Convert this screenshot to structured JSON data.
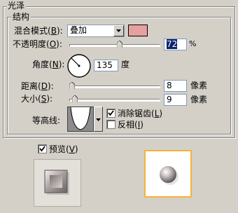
{
  "section_title": "光泽",
  "group_title": "结构",
  "blend_mode": {
    "label": "混合模式",
    "hotkey": "B",
    "value": "叠加",
    "color": "#e6a0a0"
  },
  "opacity": {
    "label": "不透明度",
    "hotkey": "O",
    "value": "72",
    "unit": "%",
    "level_percent": 72
  },
  "angle": {
    "label": "角度",
    "hotkey": "N",
    "value": "135",
    "unit": "度"
  },
  "distance": {
    "label": "距离",
    "hotkey": "D",
    "value": "8",
    "unit": "像素"
  },
  "size": {
    "label": "大小",
    "hotkey": "S",
    "value": "9",
    "unit": "像素"
  },
  "contour": {
    "label": "等高线"
  },
  "antialias": {
    "label": "消除锯齿",
    "hotkey": "L",
    "checked": true
  },
  "invert": {
    "label": "反相",
    "hotkey": "I",
    "checked": false
  },
  "preview": {
    "label": "预览",
    "hotkey": "V",
    "checked": true
  },
  "icons": {
    "dropdown": "chevron-down-icon",
    "angle_dial": "angle-dial-icon",
    "slider": "slider-thumb-icon",
    "contour": "contour-curve-icon",
    "check": "checkmark-icon",
    "sphere": "sphere-preview-icon",
    "style_swatch": "style-swatch-icon"
  }
}
